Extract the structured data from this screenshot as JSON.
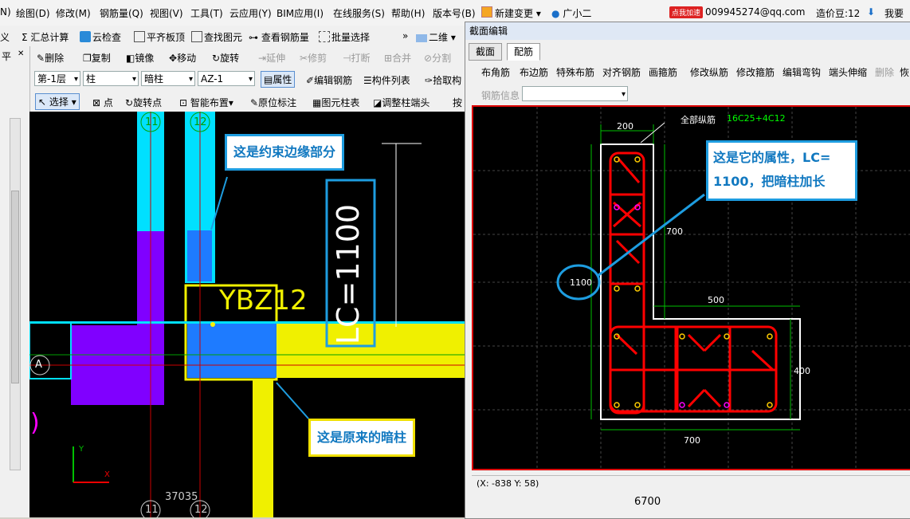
{
  "menu": {
    "items": [
      "N)",
      "绘图(D)",
      "修改(M)",
      "钢筋量(Q)",
      "视图(V)",
      "工具(T)",
      "云应用(Y)",
      "BIM应用(I)",
      "在线服务(S)",
      "帮助(H)",
      "版本号(B)",
      "新建变更",
      "广小二"
    ],
    "email": "009945274@qq.com",
    "cost_beans": "造价豆:12",
    "me_label": "我要",
    "promo": "点我加速"
  },
  "toolbar1": {
    "items": [
      "义",
      "汇总计算",
      "云检查",
      "平齐板顶",
      "查找图元",
      "查看钢筋量",
      "批量选择",
      "二维"
    ]
  },
  "toolbar2": {
    "items": [
      "删除",
      "复制",
      "镜像",
      "移动",
      "旋转",
      "延伸",
      "修剪",
      "打断",
      "合并",
      "分割"
    ],
    "left_label": "平"
  },
  "toolbar3": {
    "floor": "第-1层",
    "type": "柱",
    "subtype": "暗柱",
    "member": "AZ-1",
    "items": [
      "属性",
      "编辑钢筋",
      "构件列表",
      "拾取构"
    ]
  },
  "toolbar4": {
    "items": [
      "选择",
      "点",
      "旋转点",
      "智能布置",
      "原位标注",
      "图元柱表",
      "调整柱端头",
      "按"
    ]
  },
  "canvas": {
    "axis_top": [
      "11",
      "12"
    ],
    "axis_bottom": [
      "11",
      "12"
    ],
    "axis_left": "A",
    "member_label": "YBZ12",
    "lc_label": "LC=1100",
    "dim_bottom": "37035",
    "dim_right": "6700"
  },
  "callouts": {
    "edge": "这是约束边缘部分",
    "original": "这是原来的暗柱",
    "property_line1": "这是它的属性，LC=",
    "property_line2": "1100，把暗柱加长"
  },
  "dialog": {
    "title": "截面编辑",
    "tabs": [
      "截面",
      "配筋"
    ],
    "tools": [
      "布角筋",
      "布边筋",
      "特殊布筋",
      "对齐钢筋",
      "画箍筋",
      "修改纵筋",
      "修改箍筋",
      "编辑弯钩",
      "端头伸缩",
      "删除",
      "恢"
    ],
    "rebar_info_label": "钢筋信息",
    "rebar_info_value": "",
    "status": "(X: -838 Y: 58)"
  },
  "section": {
    "total_rebar_label": "全部纵筋",
    "total_rebar_value": "16C25+4C12",
    "dims": [
      "200",
      "700",
      "1100",
      "500",
      "400",
      "700"
    ]
  },
  "colors": {
    "highlight": "#1e9de0",
    "rebar": "#ff0000",
    "column_yellow": "#f0f000",
    "wall_cyan": "#00e0ff"
  }
}
